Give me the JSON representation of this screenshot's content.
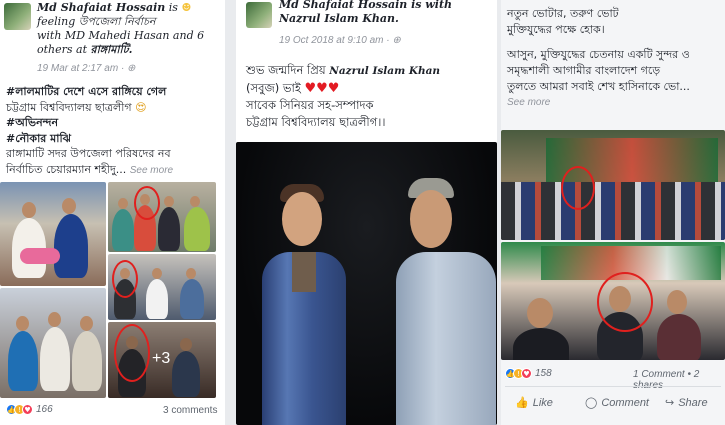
{
  "post1": {
    "author": "Md Shafaiat Hossain",
    "activity_pre": "is",
    "activity": "feeling উপজেলা নির্বাচন",
    "with_text": "with MD Mahedi Hasan and 6 others at",
    "place": "রাঙ্গামাটি.",
    "date": "19 Mar at 2:17 am",
    "line1": "#লালমাটির দেশে এসে রাঙ্গিয়ে গেল",
    "line2": "চট্টগ্রাম বিশ্ববিদ্যালয় ছাত্রলীগ",
    "line3": "#অভিনন্দন",
    "line4": "#নৌকার মাঝি",
    "line5": "রাঙ্গামাটি সদর উপজেলা পরিষদের নব",
    "line6": "নির্বাচিত চেয়ারম্যান শহীদু...",
    "see_more": "See more",
    "more_photos": "+3",
    "reaction_count": "166",
    "comments": "3 comments"
  },
  "post2": {
    "author_line1": "Md Shafaiat Hossain is with",
    "author_line2": "Nazrul Islam Khan.",
    "date": "19 Oct 2018 at 9:10 am",
    "line1": "শুভ জন্মদিন প্রিয়",
    "tag_name": "Nazrul Islam Khan",
    "line2a": "(সবুজ)",
    "line2b": "ভাই",
    "line3": "সাবেক সিনিয়র সহ-সম্পাদক",
    "line4": "চট্টগ্রাম বিশ্ববিদ্যালয় ছাত্রলীগ।।"
  },
  "post3": {
    "line1": "নতুন ভোটার, তরুণ ভোট",
    "line2": "মুক্তিযুদ্ধের পক্ষে হোক।",
    "line3": "আসুন, মুক্তিযুদ্ধের চেতনায় একটি সুন্দর ও",
    "line4": "সমৃদ্ধশালী আগামীর বাংলাদেশ গড়ে",
    "line5": "তুলতে আমরা সবাই শেখ হাসিনাকে ভো...",
    "see_more": "See more",
    "reaction_count": "158",
    "comments_shares": "1 Comment • 2 shares",
    "like_label": "Like",
    "comment_label": "Comment",
    "share_label": "Share"
  },
  "colors": {
    "ring": "#e0201e",
    "link": "#385898",
    "muted": "#90949c"
  }
}
